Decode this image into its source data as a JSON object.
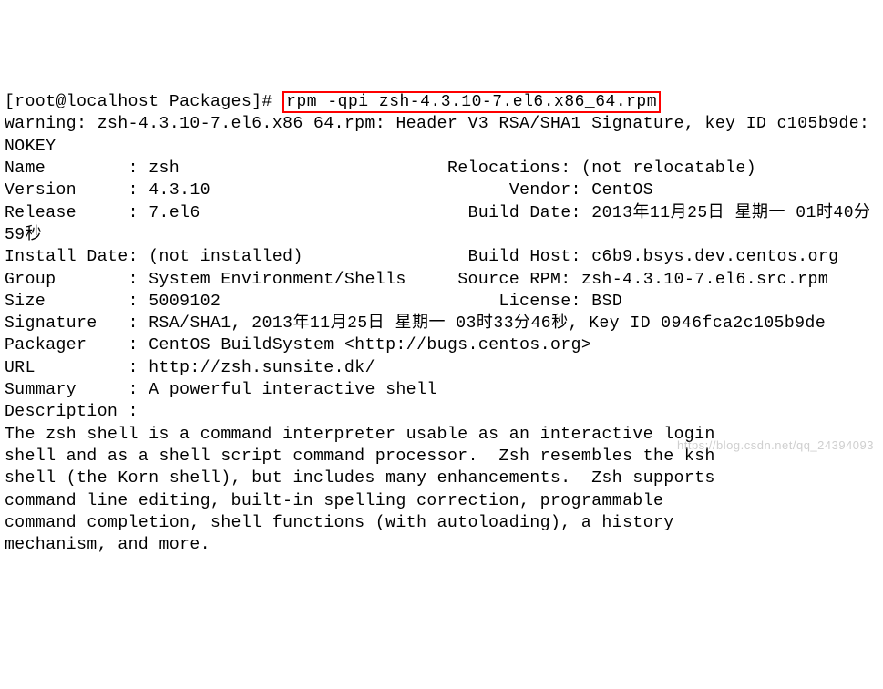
{
  "terminal": {
    "prompt": "[root@localhost Packages]#",
    "command": "rpm -qpi zsh-4.3.10-7.el6.x86_64.rpm",
    "warning": "warning: zsh-4.3.10-7.el6.x86_64.rpm: Header V3 RSA/SHA1 Signature, key ID c105b9de: NOKEY",
    "fields": {
      "name_label": "Name        :",
      "name_value": "zsh",
      "relocations_label": "Relocations:",
      "relocations_value": "(not relocatable)",
      "version_label": "Version     :",
      "version_value": "4.3.10",
      "vendor_label": "Vendor:",
      "vendor_value": "CentOS",
      "release_label": "Release     :",
      "release_value": "7.el6",
      "builddate_label": "Build Date:",
      "builddate_value": "2013年11月25日 星期一 01时40分59秒",
      "installdate_label": "Install Date:",
      "installdate_value": "(not installed)",
      "buildhost_label": "Build Host:",
      "buildhost_value": "c6b9.bsys.dev.centos.org",
      "group_label": "Group       :",
      "group_value": "System Environment/Shells",
      "sourcerpm_label": "Source RPM:",
      "sourcerpm_value": "zsh-4.3.10-7.el6.src.rpm",
      "size_label": "Size        :",
      "size_value": "5009102",
      "license_label": "License:",
      "license_value": "BSD",
      "signature_label": "Signature   :",
      "signature_value": "RSA/SHA1, 2013年11月25日 星期一 03时33分46秒, Key ID 0946fca2c105b9de",
      "packager_label": "Packager    :",
      "packager_value": "CentOS BuildSystem <http://bugs.centos.org>",
      "url_label": "URL         :",
      "url_value": "http://zsh.sunsite.dk/",
      "summary_label": "Summary     :",
      "summary_value": "A powerful interactive shell",
      "description_label": "Description :",
      "description_text": "The zsh shell is a command interpreter usable as an interactive login\nshell and as a shell script command processor.  Zsh resembles the ksh\nshell (the Korn shell), but includes many enhancements.  Zsh supports\ncommand line editing, built-in spelling correction, programmable\ncommand completion, shell functions (with autoloading), a history\nmechanism, and more."
    },
    "watermark": "https://blog.csdn.net/qq_24394093"
  }
}
